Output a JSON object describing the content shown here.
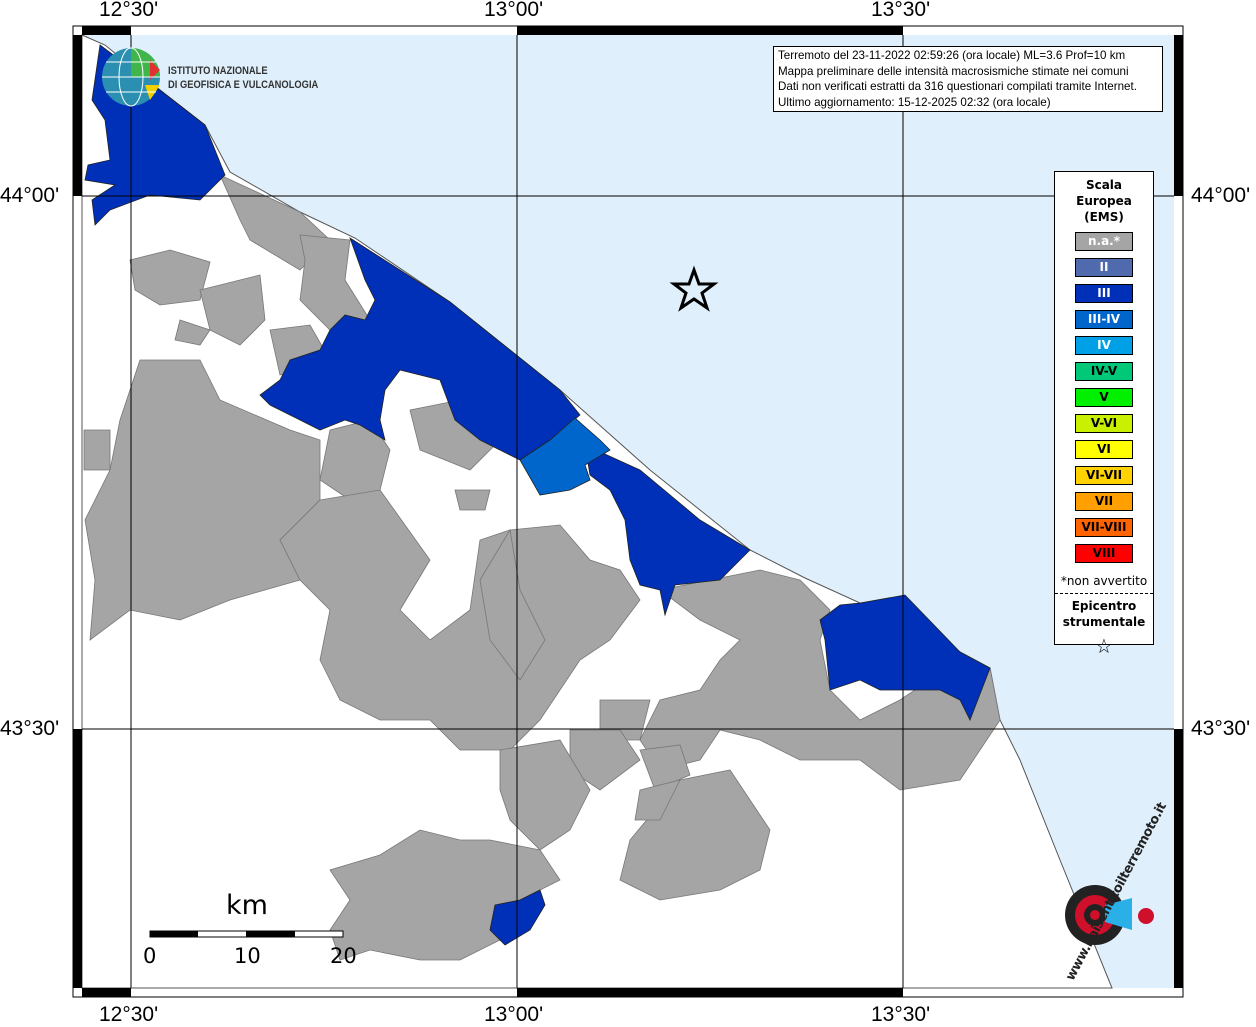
{
  "axes": {
    "top": [
      "12°30'",
      "13°00'",
      "13°30'"
    ],
    "bottom": [
      "12°30'",
      "13°00'",
      "13°30'"
    ],
    "left": [
      "44°00'",
      "43°30'"
    ],
    "right": [
      "44°00'",
      "43°30'"
    ]
  },
  "logo": {
    "line1": "ISTITUTO NAZIONALE",
    "line2": "DI GEOFISICA E VULCANOLOGIA"
  },
  "info": [
    "Terremoto del 23-11-2022 02:59:26 (ora locale) ML=3.6 Prof=10 km",
    "Mappa preliminare delle intensità macrosismiche stimate nei comuni",
    "Dati non verificati estratti da 316 questionari compilati tramite Internet.",
    "Ultimo aggiornamento: 15-12-2025 02:32 (ora locale)"
  ],
  "legend": {
    "title": [
      "Scala",
      "Europea",
      "(EMS)"
    ],
    "items": [
      {
        "label": "n.a.*",
        "color": "#a5a5a5",
        "text": "#fff"
      },
      {
        "label": "II",
        "color": "#4f6aad",
        "text": "#fff"
      },
      {
        "label": "III",
        "color": "#0030b8",
        "text": "#fff"
      },
      {
        "label": "III-IV",
        "color": "#0066cc",
        "text": "#fff"
      },
      {
        "label": "IV",
        "color": "#00a0e6",
        "text": "#fff"
      },
      {
        "label": "IV-V",
        "color": "#00c878",
        "text": "#000"
      },
      {
        "label": "V",
        "color": "#00f000",
        "text": "#000"
      },
      {
        "label": "V-VI",
        "color": "#c8f000",
        "text": "#000"
      },
      {
        "label": "VI",
        "color": "#ffff00",
        "text": "#000"
      },
      {
        "label": "VI-VII",
        "color": "#ffd200",
        "text": "#000"
      },
      {
        "label": "VII",
        "color": "#ffa000",
        "text": "#000"
      },
      {
        "label": "VII-VIII",
        "color": "#ff6400",
        "text": "#000"
      },
      {
        "label": "VIII",
        "color": "#ff0000",
        "text": "#000"
      }
    ],
    "note": "*non avvertito",
    "epicenter": [
      "Epicentro",
      "strumentale"
    ]
  },
  "scalebar": {
    "unit": "km",
    "ticks": [
      "0",
      "10",
      "20"
    ]
  },
  "watermark": "www.haisentitoilterremoto.it",
  "colors": {
    "sea": "#dff0fc",
    "land": "#ffffff",
    "grey": "#a5a5a5",
    "blue": "#0030b8",
    "blue34": "#0066cc"
  }
}
